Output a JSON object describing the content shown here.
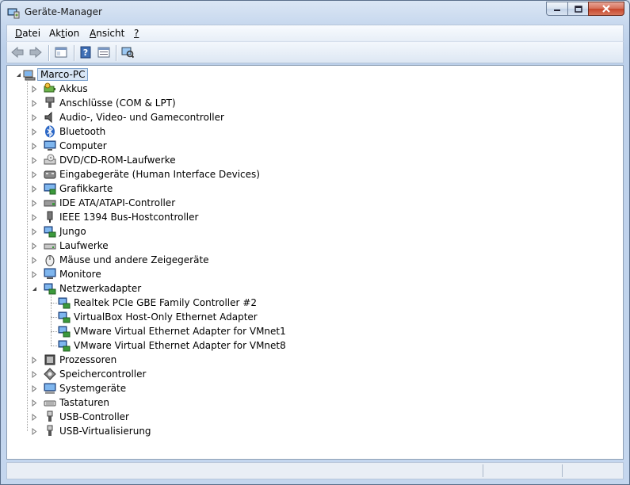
{
  "window": {
    "title": "Geräte-Manager"
  },
  "menu": [
    {
      "pre": "",
      "key": "D",
      "post": "atei"
    },
    {
      "pre": "Ak",
      "key": "t",
      "post": "ion"
    },
    {
      "pre": "",
      "key": "A",
      "post": "nsicht"
    },
    {
      "pre": "",
      "key": "?",
      "post": ""
    }
  ],
  "toolbar": [
    "back-icon",
    "forward-icon",
    "show-hide-console-tree-icon",
    "help-icon",
    "properties-icon",
    "scan-hardware-icon"
  ],
  "tree": {
    "root": "Marco-PC",
    "categories": [
      {
        "label": "Akkus",
        "icon": "battery-icon"
      },
      {
        "label": "Anschlüsse (COM & LPT)",
        "icon": "port-icon"
      },
      {
        "label": "Audio-, Video- und Gamecontroller",
        "icon": "speaker-icon"
      },
      {
        "label": "Bluetooth",
        "icon": "bluetooth-icon"
      },
      {
        "label": "Computer",
        "icon": "computer-icon"
      },
      {
        "label": "DVD/CD-ROM-Laufwerke",
        "icon": "dvd-drive-icon"
      },
      {
        "label": "Eingabegeräte (Human Interface Devices)",
        "icon": "hid-icon"
      },
      {
        "label": "Grafikkarte",
        "icon": "display-adapter-icon"
      },
      {
        "label": "IDE ATA/ATAPI-Controller",
        "icon": "ide-controller-icon"
      },
      {
        "label": "IEEE 1394 Bus-Hostcontroller",
        "icon": "firewire-icon"
      },
      {
        "label": "Jungo",
        "icon": "network-device-icon"
      },
      {
        "label": "Laufwerke",
        "icon": "disk-drive-icon"
      },
      {
        "label": "Mäuse und andere Zeigegeräte",
        "icon": "mouse-icon"
      },
      {
        "label": "Monitore",
        "icon": "monitor-icon"
      },
      {
        "label": "Netzwerkadapter",
        "icon": "network-adapter-icon",
        "expanded": true,
        "children": [
          "Realtek PCIe GBE Family Controller #2",
          "VirtualBox Host-Only Ethernet Adapter",
          "VMware Virtual Ethernet Adapter for VMnet1",
          "VMware Virtual Ethernet Adapter for VMnet8"
        ]
      },
      {
        "label": "Prozessoren",
        "icon": "processor-icon"
      },
      {
        "label": "Speichercontroller",
        "icon": "storage-controller-icon"
      },
      {
        "label": "Systemgeräte",
        "icon": "system-device-icon"
      },
      {
        "label": "Tastaturen",
        "icon": "keyboard-icon"
      },
      {
        "label": "USB-Controller",
        "icon": "usb-icon"
      },
      {
        "label": "USB-Virtualisierung",
        "icon": "usb-icon"
      }
    ]
  }
}
